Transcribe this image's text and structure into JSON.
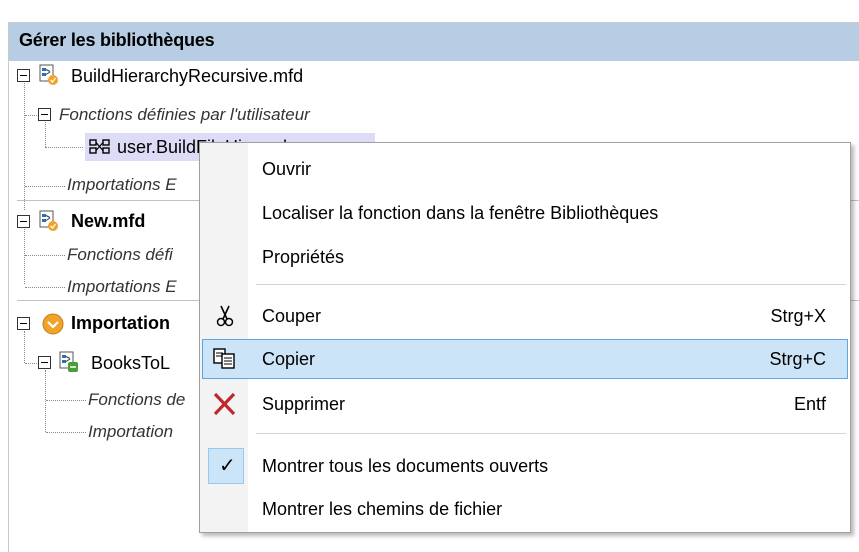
{
  "panel": {
    "title": "Gérer les bibliothèques",
    "tree": {
      "file1": {
        "name": "BuildHierarchyRecursive.mfd",
        "udf_group": "Fonctions définies par l'utilisateur",
        "udf_item": "user.BuildFileHierarch",
        "imports": "Importations E"
      },
      "file2": {
        "name": "New.mfd",
        "udf_group": "Fonctions défi",
        "imports": "Importations E"
      },
      "imports_group": {
        "name": "Importation",
        "child": {
          "name": "BooksToL",
          "udf_group": "Fonctions de",
          "imports": "Importation"
        }
      }
    }
  },
  "context_menu": {
    "items": [
      {
        "id": "open",
        "label": "Ouvrir"
      },
      {
        "id": "locate",
        "label": "Localiser la fonction dans la fenêtre Bibliothèques"
      },
      {
        "id": "properties",
        "label": "Propriétés"
      },
      {
        "id": "cut",
        "label": "Couper",
        "shortcut": "Strg+X",
        "icon": "scissors-icon"
      },
      {
        "id": "copy",
        "label": "Copier",
        "shortcut": "Strg+C",
        "icon": "copy-icon",
        "highlighted": true
      },
      {
        "id": "delete",
        "label": "Supprimer",
        "shortcut": "Entf",
        "icon": "delete-x-icon"
      },
      {
        "id": "show_all",
        "label": "Montrer tous les documents ouverts",
        "checked": true
      },
      {
        "id": "show_paths",
        "label": "Montrer les chemins de fichier"
      }
    ]
  },
  "colors": {
    "header_bg": "#b7cde4",
    "menu_highlight": "#cce4f7",
    "menu_highlight_border": "#5fa6e0",
    "delete_red": "#c0272d",
    "imports_orange": "#f0a22b"
  }
}
